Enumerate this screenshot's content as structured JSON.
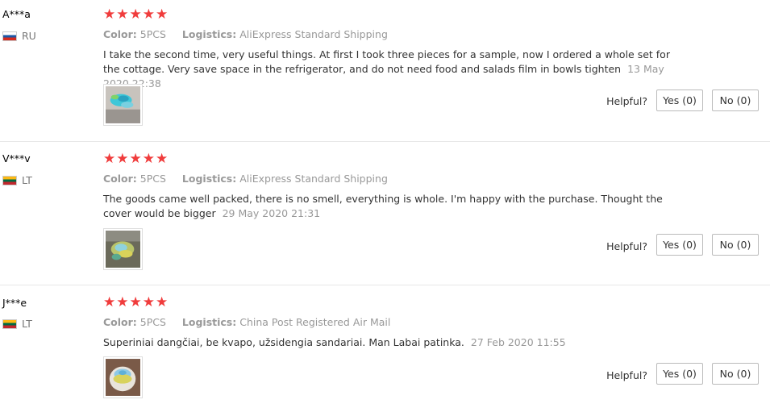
{
  "labels": {
    "color": "Color:",
    "logistics": "Logistics:",
    "helpful": "Helpful?",
    "yes": "Yes (0)",
    "no": "No (0)"
  },
  "reviews": [
    {
      "user": "A***a",
      "country": "RU",
      "flag_colors": [
        "#ffffff",
        "#1c57a5",
        "#d52b1e"
      ],
      "stars": "★★★★★",
      "color": "5PCS",
      "logistics": "AliExpress Standard Shipping",
      "text": "I take the second time, very useful things. At first I took three pieces for a sample, now I ordered a whole set for the cottage. Very save space in the refrigerator, and do not need food and salads film in bowls tighten",
      "date": "13 May 2020 22:38"
    },
    {
      "user": "V***v",
      "country": "LT",
      "flag_colors": [
        "#fdb913",
        "#006a44",
        "#c1272d"
      ],
      "stars": "★★★★★",
      "color": "5PCS",
      "logistics": "AliExpress Standard Shipping",
      "text": "The goods came well packed, there is no smell, everything is whole. I'm happy with the purchase. Thought the cover would be bigger",
      "date": "29 May 2020 21:31"
    },
    {
      "user": "J***e",
      "country": "LT",
      "flag_colors": [
        "#fdb913",
        "#006a44",
        "#c1272d"
      ],
      "stars": "★★★★★",
      "color": "5PCS",
      "logistics": "China Post Registered Air Mail",
      "text": "Superiniai dangčiai, be kvapo, užsidengia sandariai. Man Labai patinka.",
      "date": "27 Feb 2020 11:55"
    }
  ]
}
